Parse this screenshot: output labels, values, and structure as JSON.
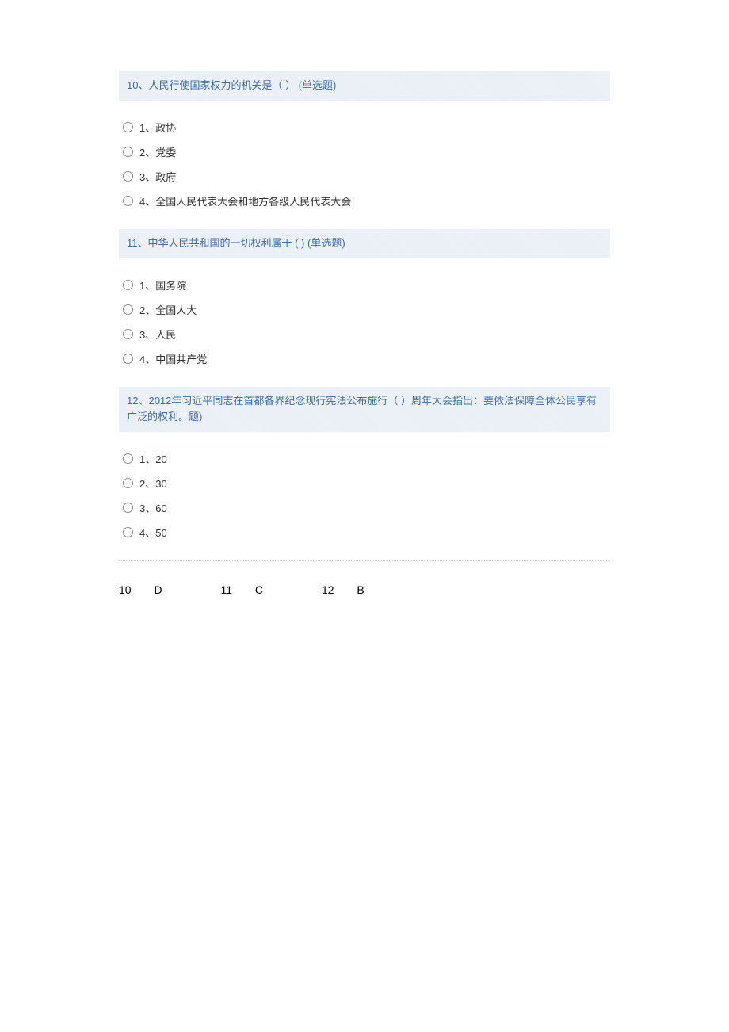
{
  "questions": [
    {
      "id": "q10",
      "header": "10、人民行使国家权力的机关是（ ） (单选题)",
      "options": [
        {
          "label": "1、政协"
        },
        {
          "label": "2、党委"
        },
        {
          "label": "3、政府"
        },
        {
          "label": "4、全国人民代表大会和地方各级人民代表大会"
        }
      ]
    },
    {
      "id": "q11",
      "header": "11、中华人民共和国的一切权利属于 ( ) (单选题)",
      "options": [
        {
          "label": "1、国务院"
        },
        {
          "label": "2、全国人大"
        },
        {
          "label": "3、人民"
        },
        {
          "label": "4、中国共产党"
        }
      ]
    },
    {
      "id": "q12",
      "header": "12、2012年习近平同志在首都各界纪念现行宪法公布施行（ ）周年大会指出：要依法保障全体公民享有广泛的权利。题)",
      "options": [
        {
          "label": "1、20"
        },
        {
          "label": "2、30"
        },
        {
          "label": "3、60"
        },
        {
          "label": "4、50"
        }
      ]
    }
  ],
  "answers": [
    {
      "num": "10",
      "letter": "D"
    },
    {
      "num": "11",
      "letter": "C"
    },
    {
      "num": "12",
      "letter": "B"
    }
  ]
}
